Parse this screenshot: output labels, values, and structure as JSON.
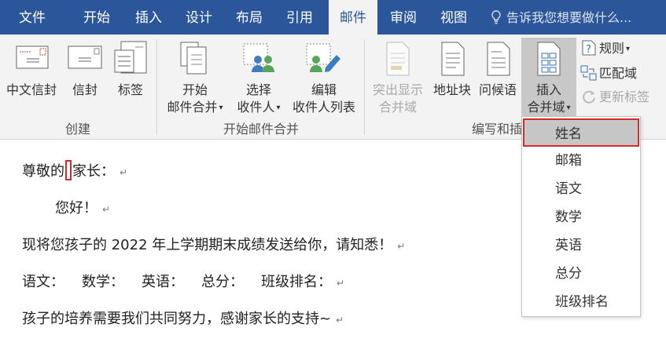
{
  "menu": {
    "tabs": [
      {
        "label": "文件"
      },
      {
        "label": "开始"
      },
      {
        "label": "插入"
      },
      {
        "label": "设计"
      },
      {
        "label": "布局"
      },
      {
        "label": "引用"
      },
      {
        "label": "邮件"
      },
      {
        "label": "审阅"
      },
      {
        "label": "视图"
      }
    ],
    "active_tab": "邮件",
    "tell_me": "告诉我您想要做什么..."
  },
  "ribbon": {
    "create": {
      "label": "创建",
      "chinese_envelope": "中文信封",
      "envelope": "信封",
      "labels": "标签"
    },
    "start_merge": {
      "label": "开始邮件合并",
      "start_line1": "开始",
      "start_line2": "邮件合并",
      "select_line1": "选择",
      "select_line2": "收件人",
      "edit_line1": "编辑",
      "edit_line2": "收件人列表"
    },
    "write_insert": {
      "label": "编写和插",
      "highlight_line1": "突出显示",
      "highlight_line2": "合并域",
      "address_block": "地址块",
      "greeting": "问候语",
      "insert_line1": "插入",
      "insert_line2": "合并域",
      "rules": "规则",
      "match_fields": "匹配域",
      "update_labels": "更新标签"
    }
  },
  "document": {
    "line1_a": "尊敬的",
    "line1_b": "家长：",
    "line2": "您好！",
    "line3": "现将您孩子的 2022 年上学期期末成绩发送给你，请知悉！",
    "line4": [
      "语文：",
      "数学：",
      "英语：",
      "总分：",
      "班级排名："
    ],
    "line5": "孩子的培养需要我们共同努力，感谢家长的支持~",
    "paragraph_mark": "↵"
  },
  "dropdown": {
    "items": [
      "姓名",
      "邮箱",
      "语文",
      "数学",
      "英语",
      "总分",
      "班级排名"
    ],
    "selected": "姓名"
  },
  "colors": {
    "accent": "#2b579a",
    "highlight": "#d42a2a"
  }
}
